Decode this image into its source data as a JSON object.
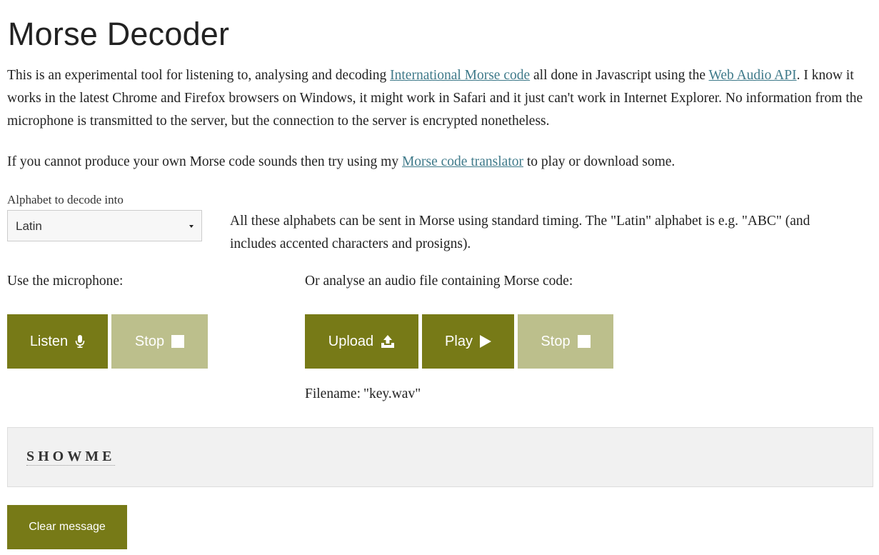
{
  "page": {
    "title": "Morse Decoder"
  },
  "intro": {
    "part1": "This is an experimental tool for listening to, analysing and decoding ",
    "link1": "International Morse code",
    "part2": " all done in Javascript using the ",
    "link2": "Web Audio API",
    "part3": ". I know it works in the latest Chrome and Firefox browsers on Windows, it might work in Safari and it just can't work in Internet Explorer. No information from the microphone is transmitted to the server, but the connection to the server is encrypted nonetheless.",
    "line2_part1": "If you cannot produce your own Morse code sounds then try using my ",
    "line2_link": "Morse code translator",
    "line2_part2": " to play or download some."
  },
  "alphabet": {
    "label": "Alphabet to decode into",
    "selected": "Latin",
    "note": "All these alphabets can be sent in Morse using standard timing. The \"Latin\" alphabet is e.g. \"ABC\" (and includes accented characters and prosigns)."
  },
  "microphone": {
    "label": "Use the microphone:",
    "listen_label": "Listen",
    "listen_icon": "microphone-icon",
    "stop_label": "Stop",
    "stop_icon": "stop-square-icon"
  },
  "file": {
    "label": "Or analyse an audio file containing Morse code:",
    "upload_label": "Upload",
    "upload_icon": "upload-icon",
    "play_label": "Play",
    "play_icon": "play-triangle-icon",
    "stop_label": "Stop",
    "stop_icon": "stop-square-icon",
    "filename_label": "Filename:",
    "filename_value": "\"key.wav\""
  },
  "output": {
    "message": "SHOWME"
  },
  "actions": {
    "clear_label": "Clear message"
  },
  "colors": {
    "button_active": "#777a17",
    "button_disabled": "#bcbf8c",
    "link": "#3f7a8a",
    "output_bg": "#f1f1f1"
  }
}
